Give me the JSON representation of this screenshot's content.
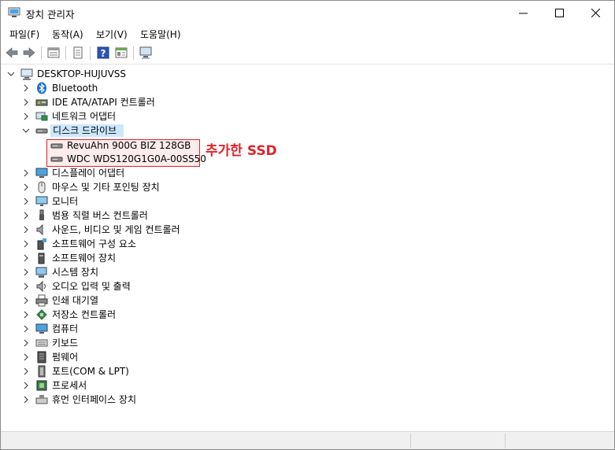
{
  "window": {
    "title": "장치 관리자",
    "controls": {
      "minimize": "—",
      "maximize": "☐",
      "close": "✕"
    }
  },
  "menu": [
    "파일(F)",
    "동작(A)",
    "보기(V)",
    "도움말(H)"
  ],
  "tree": {
    "root": "DESKTOP-HUJUVSS",
    "categories": [
      {
        "label": "Bluetooth",
        "icon": "bluetooth-icon"
      },
      {
        "label": "IDE ATA/ATAPI 컨트롤러",
        "icon": "ide-controller-icon"
      },
      {
        "label": "네트워크 어댑터",
        "icon": "network-adapter-icon"
      },
      {
        "label": "디스크 드라이브",
        "icon": "disk-drive-icon",
        "expanded": true,
        "children": [
          "RevuAhn 900G BIZ 128GB",
          "WDC WDS120G1G0A-00SS50"
        ]
      },
      {
        "label": "디스플레이 어댑터",
        "icon": "display-adapter-icon"
      },
      {
        "label": "마우스 및 기타 포인팅 장치",
        "icon": "mouse-icon"
      },
      {
        "label": "모니터",
        "icon": "monitor-icon"
      },
      {
        "label": "범용 직렬 버스 컨트롤러",
        "icon": "usb-icon"
      },
      {
        "label": "사운드, 비디오 및 게임 컨트롤러",
        "icon": "speaker-icon"
      },
      {
        "label": "소프트웨어 구성 요소",
        "icon": "software-component-icon"
      },
      {
        "label": "소프트웨어 장치",
        "icon": "software-device-icon"
      },
      {
        "label": "시스템 장치",
        "icon": "system-device-icon"
      },
      {
        "label": "오디오 입력 및 출력",
        "icon": "audio-io-icon"
      },
      {
        "label": "인쇄 대기열",
        "icon": "printer-icon"
      },
      {
        "label": "저장소 컨트롤러",
        "icon": "storage-controller-icon"
      },
      {
        "label": "컴퓨터",
        "icon": "computer-icon"
      },
      {
        "label": "키보드",
        "icon": "keyboard-icon"
      },
      {
        "label": "펌웨어",
        "icon": "firmware-icon"
      },
      {
        "label": "포트(COM & LPT)",
        "icon": "port-icon"
      },
      {
        "label": "프로세서",
        "icon": "processor-icon"
      },
      {
        "label": "휴먼 인터페이스 장치",
        "icon": "hid-icon"
      }
    ]
  },
  "annotation": "추가한 SSD",
  "colors": {
    "annotation": "#e0242a",
    "selection": "#cce8ff"
  }
}
